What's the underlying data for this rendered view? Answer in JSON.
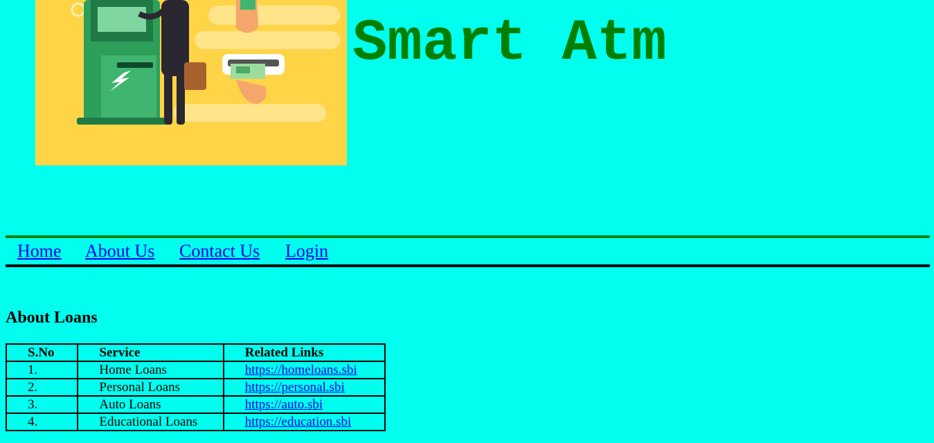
{
  "header": {
    "title": "Smart Atm",
    "banner_image": "atm-illustration"
  },
  "nav": {
    "items": [
      {
        "label": "Home"
      },
      {
        "label": "About Us"
      },
      {
        "label": "Contact Us"
      },
      {
        "label": "Login"
      }
    ]
  },
  "loans": {
    "heading": "About Loans",
    "columns": [
      "S.No",
      "Service",
      "Related Links"
    ],
    "rows": [
      {
        "sno": "1.",
        "service": "Home Loans",
        "link": "https://homeloans.sbi"
      },
      {
        "sno": "2.",
        "service": "Personal Loans",
        "link": "https://personal.sbi"
      },
      {
        "sno": "3.",
        "service": "Auto Loans",
        "link": "https://auto.sbi"
      },
      {
        "sno": "4.",
        "service": "Educational Loans",
        "link": "https://education.sbi"
      }
    ]
  },
  "colors": {
    "background": "#00FFEE",
    "title": "#008000",
    "nav_top_border": "#008000",
    "nav_bottom_border": "#000000",
    "link": "#0000EE",
    "banner": "#FFD447"
  }
}
